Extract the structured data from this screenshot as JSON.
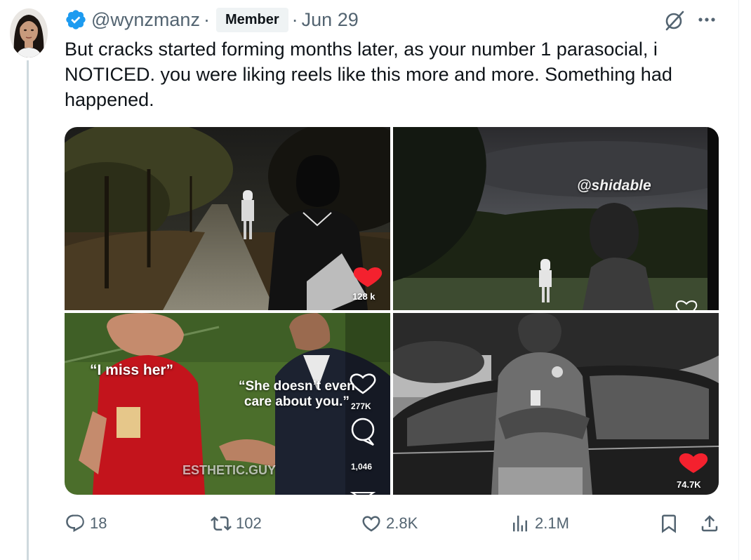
{
  "tweet": {
    "handle": "@wynzmanz",
    "badge": "Member",
    "separator": "·",
    "date": "Jun 29",
    "text": "But cracks started forming months later, as your number 1 parasocial, i NOTICED. you were liking reels like this more and more. Something had happened."
  },
  "media": {
    "tiles": [
      {
        "likes": "128 k",
        "icon": "heart-filled-icon"
      },
      {
        "watermark": "@shidable",
        "icon": "heart-outline-icon"
      },
      {
        "caption_left": "“I miss her”",
        "caption_right": "“She doesn’t even\ncare about you.”",
        "likes": "277K",
        "comments": "1,046",
        "watermark": "ESTHETIC.GUY"
      },
      {
        "likes": "74.7K",
        "icon": "heart-filled-icon"
      }
    ]
  },
  "actions": {
    "replies": "18",
    "reposts": "102",
    "likes": "2.8K",
    "views": "2.1M"
  },
  "colors": {
    "verified": "#1d9bf0",
    "secondary_text": "#536471",
    "primary_text": "#0f1419",
    "heart_red": "#f4212e"
  }
}
